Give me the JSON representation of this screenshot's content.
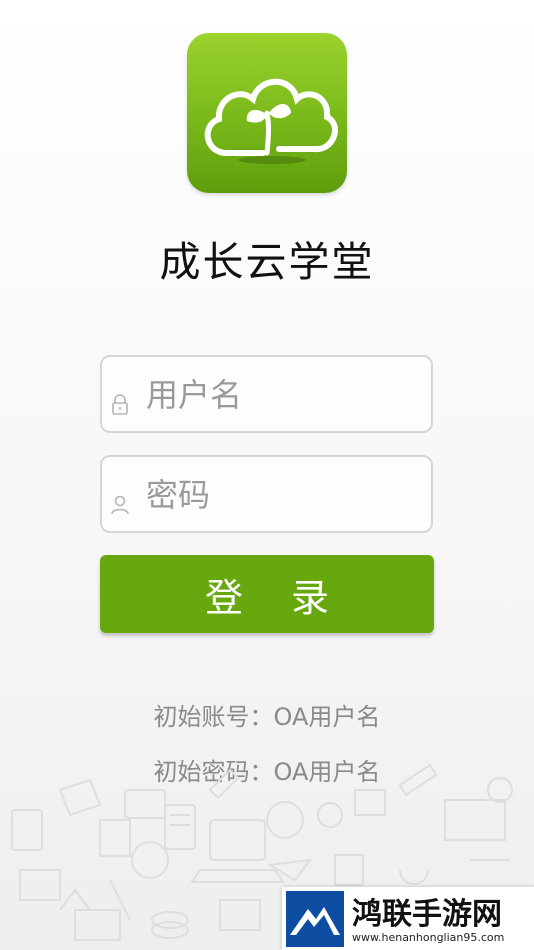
{
  "app": {
    "title": "成长云学堂",
    "icon": "cloud-sprout-icon"
  },
  "login_form": {
    "username_placeholder": "用户名",
    "username_value": "",
    "password_placeholder": "密码",
    "password_value": "",
    "login_label": "登 录"
  },
  "hints": {
    "initial_account": "初始账号：OA用户名",
    "initial_password": "初始密码：OA用户名"
  },
  "watermark": {
    "title": "鸿联手游网",
    "url": "www.henanhonglian95.com"
  },
  "colors": {
    "accent": "#67a80f",
    "icon_green": "#7cba1c"
  }
}
